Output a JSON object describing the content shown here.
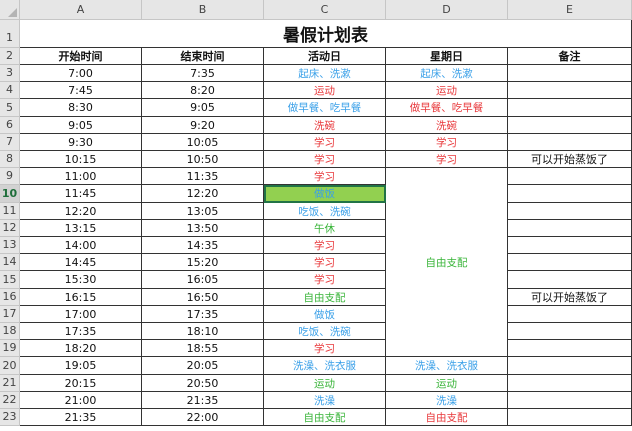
{
  "columns": [
    "A",
    "B",
    "C",
    "D",
    "E"
  ],
  "title": "暑假计划表",
  "headers": [
    "开始时间",
    "结束时间",
    "活动日",
    "星期日",
    "备注"
  ],
  "colors": {
    "red": "#e8373a",
    "blue": "#3aa0e8",
    "green": "#38b438",
    "highlight": "#92d050",
    "selection": "#217346"
  },
  "rows": [
    {
      "n": "3",
      "start": "7:00",
      "end": "7:35",
      "act": {
        "t": "起床、洗漱",
        "c": "blue"
      },
      "sun": {
        "t": "起床、洗漱",
        "c": "blue"
      },
      "note": ""
    },
    {
      "n": "4",
      "start": "7:45",
      "end": "8:20",
      "act": {
        "t": "运动",
        "c": "red"
      },
      "sun": {
        "t": "运动",
        "c": "red"
      },
      "note": ""
    },
    {
      "n": "5",
      "start": "8:30",
      "end": "9:05",
      "act": {
        "t": "做早餐、吃早餐",
        "c": "blue"
      },
      "sun": {
        "t": "做早餐、吃早餐",
        "c": "red"
      },
      "note": ""
    },
    {
      "n": "6",
      "start": "9:05",
      "end": "9:20",
      "act": {
        "t": "洗碗",
        "c": "red"
      },
      "sun": {
        "t": "洗碗",
        "c": "red"
      },
      "note": ""
    },
    {
      "n": "7",
      "start": "9:30",
      "end": "10:05",
      "act": {
        "t": "学习",
        "c": "red"
      },
      "sun": {
        "t": "学习",
        "c": "red"
      },
      "note": ""
    },
    {
      "n": "8",
      "start": "10:15",
      "end": "10:50",
      "act": {
        "t": "学习",
        "c": "red"
      },
      "sun": {
        "t": "学习",
        "c": "red"
      },
      "note": "可以开始蒸饭了"
    },
    {
      "n": "9",
      "start": "11:00",
      "end": "11:35",
      "act": {
        "t": "学习",
        "c": "red"
      },
      "note": ""
    },
    {
      "n": "10",
      "start": "11:45",
      "end": "12:20",
      "act": {
        "t": "做饭",
        "c": "blue"
      },
      "note": ""
    },
    {
      "n": "11",
      "start": "12:20",
      "end": "13:05",
      "act": {
        "t": "吃饭、洗碗",
        "c": "blue"
      },
      "note": ""
    },
    {
      "n": "12",
      "start": "13:15",
      "end": "13:50",
      "act": {
        "t": "午休",
        "c": "green"
      },
      "note": ""
    },
    {
      "n": "13",
      "start": "14:00",
      "end": "14:35",
      "act": {
        "t": "学习",
        "c": "red"
      },
      "note": ""
    },
    {
      "n": "14",
      "start": "14:45",
      "end": "15:20",
      "act": {
        "t": "学习",
        "c": "red"
      },
      "note": ""
    },
    {
      "n": "15",
      "start": "15:30",
      "end": "16:05",
      "act": {
        "t": "学习",
        "c": "red"
      },
      "note": ""
    },
    {
      "n": "16",
      "start": "16:15",
      "end": "16:50",
      "act": {
        "t": "自由支配",
        "c": "green"
      },
      "note": "可以开始蒸饭了"
    },
    {
      "n": "17",
      "start": "17:00",
      "end": "17:35",
      "act": {
        "t": "做饭",
        "c": "blue"
      },
      "note": ""
    },
    {
      "n": "18",
      "start": "17:35",
      "end": "18:10",
      "act": {
        "t": "吃饭、洗碗",
        "c": "blue"
      },
      "note": ""
    },
    {
      "n": "19",
      "start": "18:20",
      "end": "18:55",
      "act": {
        "t": "学习",
        "c": "red"
      },
      "note": ""
    },
    {
      "n": "20",
      "start": "19:05",
      "end": "20:05",
      "act": {
        "t": "洗澡、洗衣服",
        "c": "blue"
      },
      "sun": {
        "t": "洗澡、洗衣服",
        "c": "blue"
      },
      "note": ""
    },
    {
      "n": "21",
      "start": "20:15",
      "end": "20:50",
      "act": {
        "t": "运动",
        "c": "green"
      },
      "sun": {
        "t": "运动",
        "c": "green"
      },
      "note": ""
    },
    {
      "n": "22",
      "start": "21:00",
      "end": "21:35",
      "act": {
        "t": "洗澡",
        "c": "blue"
      },
      "sun": {
        "t": "洗澡",
        "c": "blue"
      },
      "note": ""
    },
    {
      "n": "23",
      "start": "21:35",
      "end": "22:00",
      "act": {
        "t": "自由支配",
        "c": "green"
      },
      "sun": {
        "t": "自由支配",
        "c": "red"
      },
      "note": ""
    }
  ],
  "merged_sunday": {
    "t": "自由支配",
    "c": "green"
  },
  "selected_row": "10"
}
